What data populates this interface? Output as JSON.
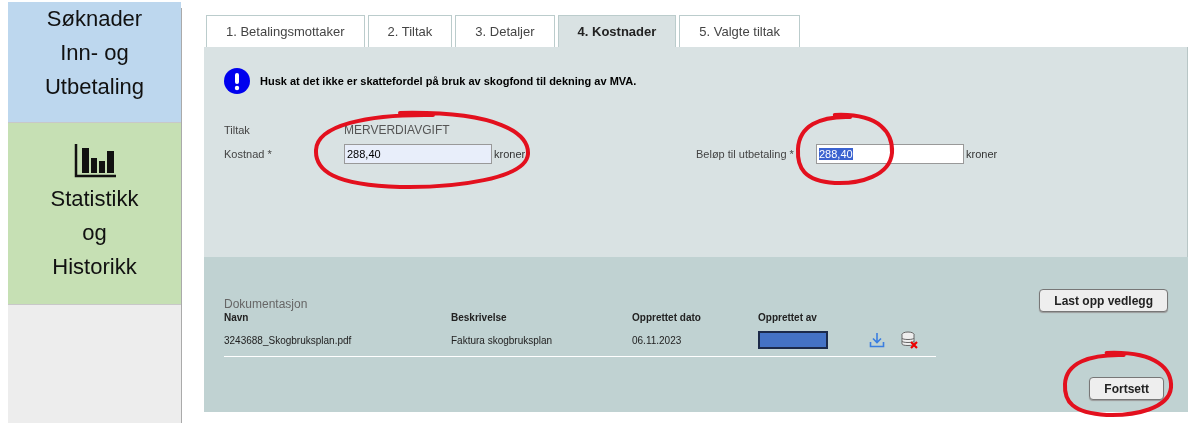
{
  "sidebar": {
    "items": [
      {
        "label": "Søknader Inn- og Utbetaling",
        "color": "#bdd7ee",
        "kind": "text"
      },
      {
        "label": "Statistikk og Historikk",
        "color": "#c6e0b4",
        "kind": "chart-link"
      }
    ]
  },
  "tabs": [
    {
      "label": "1. Betalingsmottaker",
      "selected": false
    },
    {
      "label": "2. Tiltak",
      "selected": false
    },
    {
      "label": "3. Detaljer",
      "selected": false
    },
    {
      "label": "4. Kostnader",
      "selected": true
    },
    {
      "label": "5. Valgte tiltak",
      "selected": false
    }
  ],
  "notice": "Husk at det ikke er skattefordel på bruk av skogfond til dekning av MVA.",
  "measure": {
    "label": "Tiltak",
    "value": "MERVERDIAVGIFT"
  },
  "cost": {
    "label": "Kostnad *",
    "value": "288,40",
    "unit": "kroner",
    "text_selected": false
  },
  "payout": {
    "label": "Beløp til utbetaling *",
    "value": "288,40",
    "unit": "kroner",
    "text_selected": true
  },
  "documentation": {
    "title": "Dokumentasjon",
    "upload_button": "Last opp vedlegg",
    "columns": [
      "Navn",
      "Beskrivelse",
      "Opprettet dato",
      "Opprettet av"
    ],
    "rows": [
      {
        "name": "3243688_Skogbruksplan.pdf",
        "description": "Faktura skogbruksplan",
        "date": "06.11.2023",
        "created_by_redacted": true
      }
    ]
  },
  "continue_button": "Fortsett",
  "annotations": [
    {
      "kind": "ring"
    },
    {
      "kind": "ring"
    },
    {
      "kind": "ring"
    }
  ]
}
